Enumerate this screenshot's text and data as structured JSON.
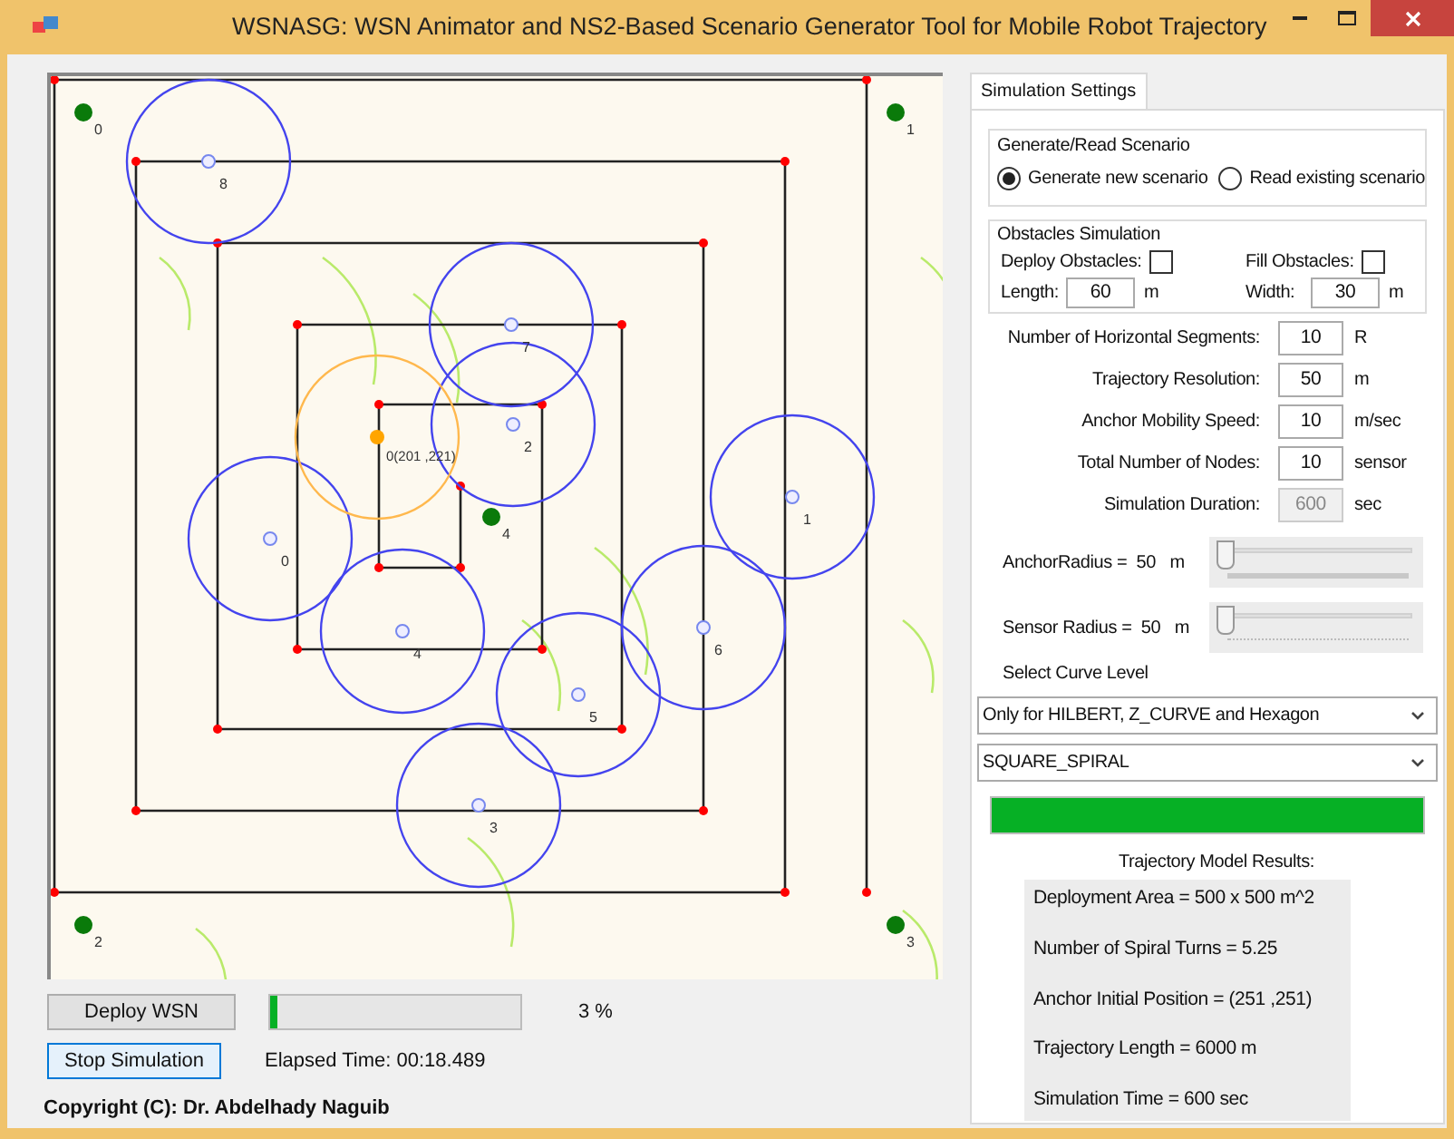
{
  "window": {
    "title": "WSNASG: WSN Animator and NS2-Based Scenario Generator Tool for Mobile Robot Trajectory"
  },
  "canvas": {
    "anchors": [
      {
        "label": "0"
      },
      {
        "label": "1"
      },
      {
        "label": "2"
      },
      {
        "label": "3"
      },
      {
        "label": "4"
      }
    ],
    "sensors": [
      {
        "label": "8"
      },
      {
        "label": "7"
      },
      {
        "label": "2"
      },
      {
        "label": "1"
      },
      {
        "label": "0"
      },
      {
        "label": "4"
      },
      {
        "label": "6"
      },
      {
        "label": "5"
      },
      {
        "label": "3"
      }
    ],
    "mobile_anchor": {
      "label": "0(201 ,221)"
    }
  },
  "controls": {
    "deploy_button": "Deploy WSN",
    "progress": {
      "level": 0.03
    },
    "progress_text": "3 %",
    "stop_button": "Stop Simulation",
    "elapsed": "Elapsed Time: 00:18.489",
    "copyright": "Copyright (C): Dr. Abdelhady Naguib"
  },
  "settings": {
    "tabs": [
      {
        "label": "Simulation Settings",
        "selected": true
      }
    ],
    "scenario": {
      "title": "Generate/Read Scenario",
      "options": [
        {
          "label": "Generate new scenario",
          "selected": true
        },
        {
          "label": "Read existing scenario",
          "selected": false
        }
      ]
    },
    "obstacles": {
      "title": "Obstacles Simulation",
      "checks": [
        {
          "label": "Deploy Obstacles:",
          "checked": false
        },
        {
          "label": "Fill Obstacles:",
          "checked": false
        }
      ],
      "fields": [
        {
          "label": "Length:",
          "value": "60",
          "unit": "m"
        },
        {
          "label": "Width:",
          "value": "30",
          "unit": "m"
        }
      ]
    },
    "params": [
      {
        "label": "Number of Horizontal Segments:",
        "value": "10",
        "unit": "R",
        "disabled": false
      },
      {
        "label": "Trajectory Resolution:",
        "value": "50",
        "unit": "m",
        "disabled": false
      },
      {
        "label": "Anchor Mobility Speed:",
        "value": "10",
        "unit": "m/sec",
        "disabled": false
      },
      {
        "label": "Total Number of Nodes:",
        "value": "10",
        "unit": "sensor",
        "disabled": false
      },
      {
        "label": "Simulation Duration:",
        "value": "600",
        "unit": "sec",
        "disabled": true
      }
    ],
    "sliders": [
      {
        "label": "AnchorRadius =  50   m",
        "level": 0
      },
      {
        "label": "Sensor Radius =  50   m",
        "level": 0
      }
    ],
    "curve_label": "Select Curve Level",
    "dropdowns": [
      {
        "value": "Only for HILBERT, Z_CURVE and Hexagon"
      },
      {
        "value": "SQUARE_SPIRAL"
      }
    ],
    "trajectory_bar": {
      "level": 1
    },
    "results": {
      "title": "Trajectory Model Results:",
      "lines": [
        "Deployment Area = 500 x 500  m^2",
        "Number of Spiral Turns = 5.25",
        "Anchor Initial Position = (251 ,251)",
        "Trajectory Length = 6000 m",
        "Simulation Time = 600 sec"
      ]
    }
  }
}
